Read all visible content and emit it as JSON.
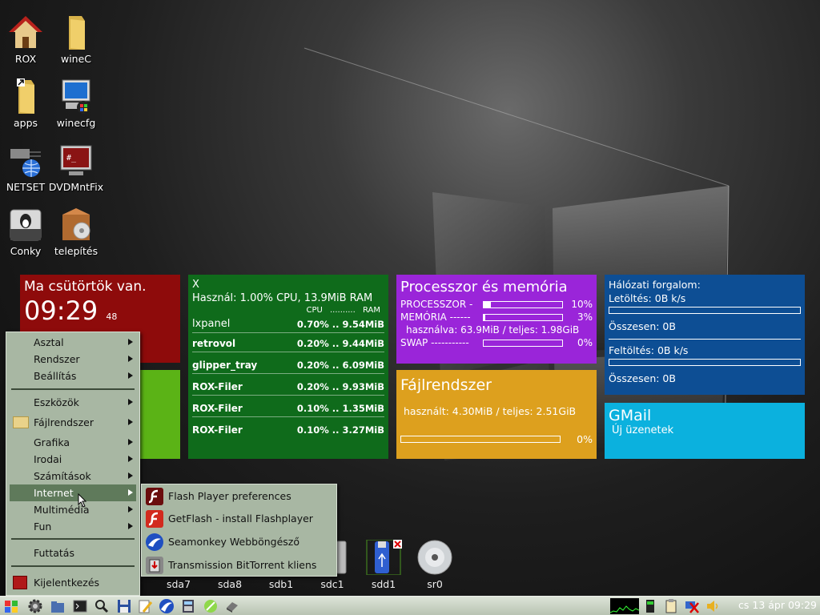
{
  "desktop_icons": [
    {
      "label": "ROX",
      "icon": "home-icon"
    },
    {
      "label": "wineC",
      "icon": "folder-icon"
    },
    {
      "label": "apps",
      "icon": "folder-icon"
    },
    {
      "label": "winecfg",
      "icon": "computer-icon"
    },
    {
      "label": "NETSET",
      "icon": "network-icon"
    },
    {
      "label": "DVDMntFix",
      "icon": "terminal-icon"
    },
    {
      "label": "Conky",
      "icon": "conky-icon"
    },
    {
      "label": "telepítés",
      "icon": "package-icon"
    }
  ],
  "clock_tile": {
    "day_text": "Ma csütörtök van.",
    "time": "09:29",
    "seconds": "48"
  },
  "process_tile": {
    "title": "X",
    "usage": "Használ:  1.00% CPU, 13.9MiB RAM",
    "col_cpu": "CPU",
    "col_dots": "..........",
    "col_ram": "RAM",
    "processes": [
      {
        "name": "lxpanel",
        "value": "0.70% .. 9.54MiB"
      },
      {
        "name": "retrovol",
        "value": "0.20% .. 9.44MiB"
      },
      {
        "name": "glipper_tray",
        "value": "0.20% .. 6.09MiB"
      },
      {
        "name": "ROX-Filer",
        "value": "0.20% .. 9.93MiB"
      },
      {
        "name": "ROX-Filer",
        "value": "0.10% .. 1.35MiB"
      },
      {
        "name": "ROX-Filer",
        "value": "0.10% .. 3.27MiB"
      }
    ]
  },
  "cpu_mem_tile": {
    "title": "Processzor és memória",
    "cpu_label": "PROCESSZOR -",
    "cpu_pct": "10%",
    "cpu_level": 0.1,
    "mem_label": "MEMÓRIA ------",
    "mem_pct": "3%",
    "mem_level": 0.03,
    "used_text": "használva: 63.9MiB / teljes: 1.98GiB",
    "swap_label": "SWAP -----------",
    "swap_pct": "0%",
    "swap_level": 0.0
  },
  "fs_tile": {
    "title": "Fájlrendszer",
    "used_text": "használt: 4.30MiB / teljes: 2.51GiB",
    "pct": "0%",
    "level": 0.0
  },
  "net_tile": {
    "title": "Hálózati forgalom:",
    "download": "Letöltés: 0B k/s",
    "down_total": "Összesen: 0B",
    "upload": "Feltöltés: 0B k/s",
    "up_total": "Összesen: 0B"
  },
  "gmail_tile": {
    "title": "GMail",
    "subtitle": "Új üzenetek"
  },
  "menu": {
    "items": [
      {
        "label": "Asztal"
      },
      {
        "label": "Rendszer"
      },
      {
        "label": "Beállítás"
      },
      {
        "label": "Eszközök"
      },
      {
        "label": "Fájlrendszer"
      },
      {
        "label": "Grafika"
      },
      {
        "label": "Irodai"
      },
      {
        "label": "Számítások"
      },
      {
        "label": "Internet"
      },
      {
        "label": "Multimédia"
      },
      {
        "label": "Fun"
      },
      {
        "label": "Futtatás"
      },
      {
        "label": "Kijelentkezés"
      }
    ]
  },
  "submenu": {
    "items": [
      {
        "label": "Flash Player preferences",
        "icon": "flash-icon"
      },
      {
        "label": "GetFlash - install Flashplayer",
        "icon": "flash-icon"
      },
      {
        "label": "Seamonkey Webböngésző",
        "icon": "seamonkey-icon"
      },
      {
        "label": "Transmission BitTorrent kliens",
        "icon": "transmission-icon"
      }
    ]
  },
  "drives": [
    {
      "label": "sda7"
    },
    {
      "label": "sda8"
    },
    {
      "label": "sdb1"
    },
    {
      "label": "sdc1"
    },
    {
      "label": "sdd1"
    },
    {
      "label": "sr0"
    }
  ],
  "taskbar": {
    "clock": "cs 13 ápr 09:29"
  },
  "colors": {
    "tile_red": "#8e0b0b",
    "tile_green": "#0f6b1b",
    "tile_light_green": "#5bb316",
    "tile_purple": "#9a25d9",
    "tile_orange": "#dda01e",
    "tile_blue": "#0d4e94",
    "tile_cyan": "#0bb1de",
    "menu_bg": "#a8b7a3"
  }
}
